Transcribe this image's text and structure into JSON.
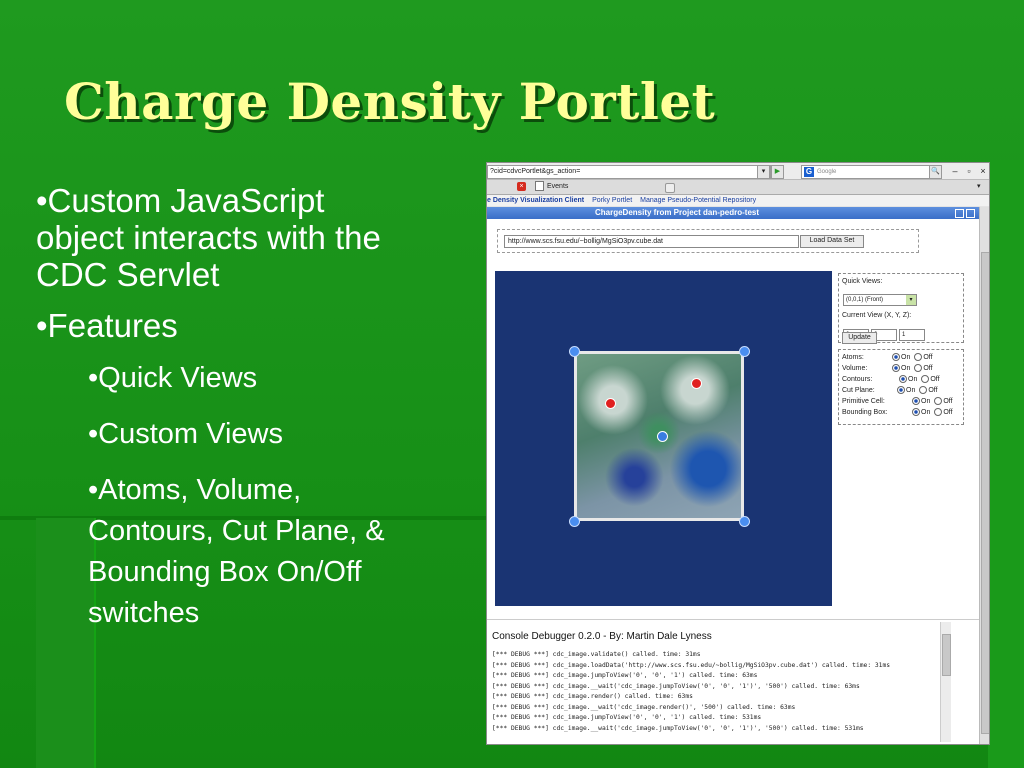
{
  "slide": {
    "title": "Charge Density Portlet",
    "bullets": [
      "•Custom JavaScript object interacts with the CDC Servlet",
      "•Features"
    ],
    "sub_bullets": [
      "•Quick Views",
      "•Custom Views",
      "•Atoms, Volume, Contours, Cut Plane, & Bounding Box On/Off switches"
    ]
  },
  "browser": {
    "url": "?cid=cdvcPortlet&gs_action=",
    "search_placeholder": "Google",
    "tab_label": "Events",
    "nav": [
      "e Density Visualization Client",
      "Porky Portlet",
      "Manage Pseudo-Potential Repository"
    ],
    "portlet_title": "ChargeDensity from Project dan-pedro-test"
  },
  "portlet": {
    "data_url": "http://www.scs.fsu.edu/~bollig/MgSiO3pv.cube.dat",
    "load_button": "Load Data Set",
    "quick_views_label": "Quick Views:",
    "quick_view_selected": "(0,0,1) (Front)",
    "current_view_label": "Current View (X, Y, Z):",
    "view_x": "0",
    "view_y": "0",
    "view_z": "1",
    "update_button": "Update",
    "on_label": "On",
    "off_label": "Off",
    "toggles": [
      {
        "label": "Atoms:",
        "state": "on"
      },
      {
        "label": "Volume:",
        "state": "on"
      },
      {
        "label": "Contours:",
        "state": "on"
      },
      {
        "label": "Cut Plane:",
        "state": "on"
      },
      {
        "label": "Primitive Cell:",
        "state": "on"
      },
      {
        "label": "Bounding Box:",
        "state": "on"
      }
    ]
  },
  "console": {
    "title": "Console Debugger 0.2.0 - By: Martin Dale Lyness",
    "lines": [
      "[*** DEBUG ***] cdc_image.validate() called. time: 31ms",
      "[*** DEBUG ***] cdc_image.loadData('http://www.scs.fsu.edu/~bollig/MgSiO3pv.cube.dat') called. time: 31ms",
      "[*** DEBUG ***] cdc_image.jumpToView('0', '0', '1') called. time: 63ms",
      "[*** DEBUG ***] cdc_image.__wait('cdc_image.jumpToView('0', '0', '1')', '500') called. time: 63ms",
      "[*** DEBUG ***] cdc_image.render() called. time: 63ms",
      "[*** DEBUG ***] cdc_image.__wait('cdc_image.render()', '500') called. time: 63ms",
      "[*** DEBUG ***] cdc_image.jumpToView('0', '0', '1') called. time: 531ms",
      "[*** DEBUG ***] cdc_image.__wait('cdc_image.jumpToView('0', '0', '1')', '500') called. time: 531ms"
    ]
  },
  "colors": {
    "slide_bg": "#1f9a1f",
    "title": "#ffff99",
    "portlet_header": "#3a6ec8",
    "viewer_bg": "#1a3473",
    "atom_red": "#e02020",
    "atom_blue": "#3a7de0"
  }
}
